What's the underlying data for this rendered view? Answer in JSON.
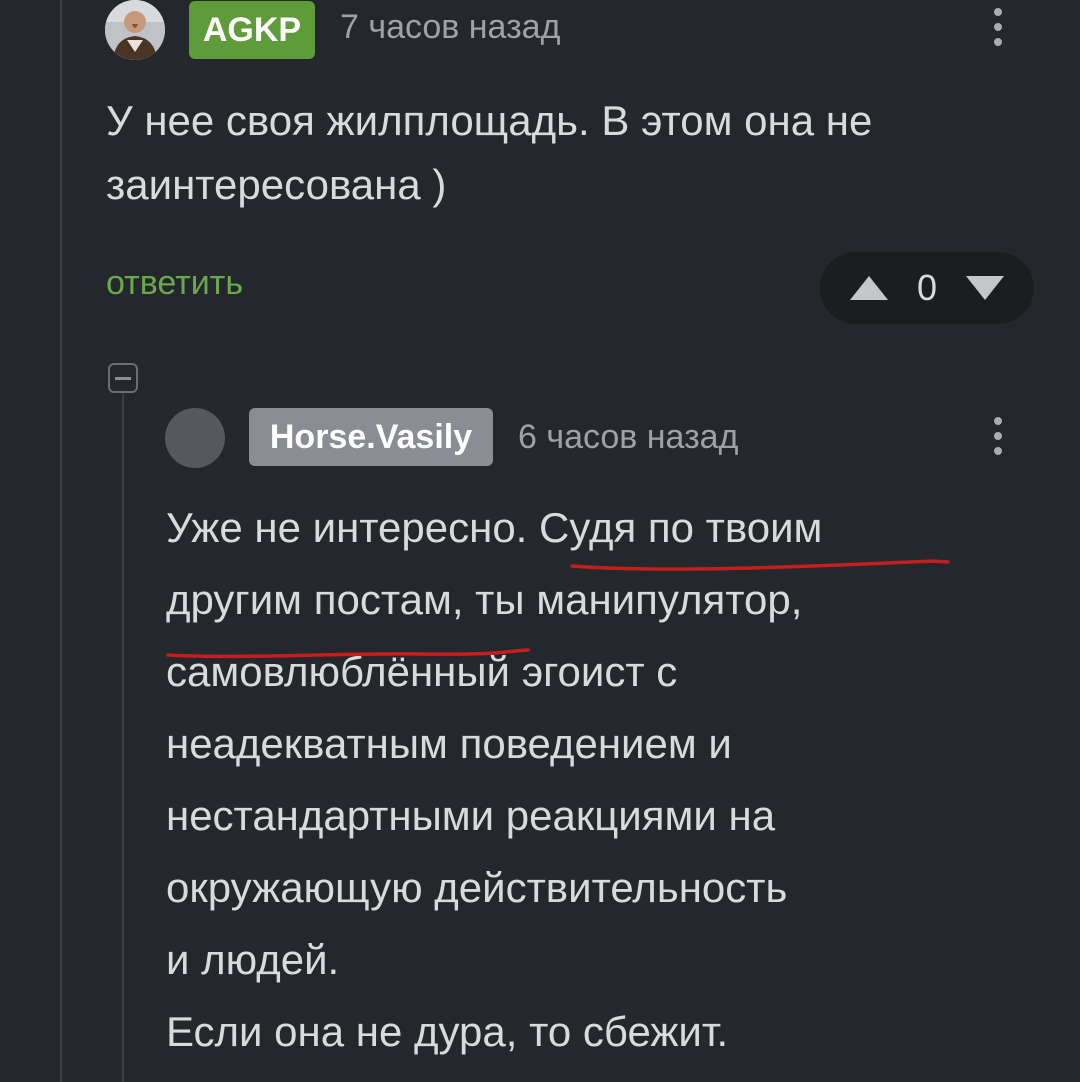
{
  "comment1": {
    "author": "AGKP",
    "time": "7 часов назад",
    "text_lines": [
      "У нее своя жилплощадь. В этом она не",
      "заинтересована )"
    ],
    "reply_label": "ответить",
    "rating": "0",
    "badge_color": "#5e9b3a"
  },
  "comment2": {
    "author": "Horse.Vasily",
    "time": "6 часов назад",
    "text_lines": [
      "Уже не интересно. Судя по твоим",
      "другим постам, ты манипулятор,",
      "самовлюблённый эгоист с",
      "неадекватным поведением и",
      "нестандартными реакциями на",
      "окружающую действительность",
      "и людей.",
      "Если она не дура, то сбежит."
    ],
    "badge_color": "#8a8d93"
  },
  "colors": {
    "background": "#24272c",
    "reply_link": "#6aa84f",
    "underline": "#c41e1e"
  }
}
